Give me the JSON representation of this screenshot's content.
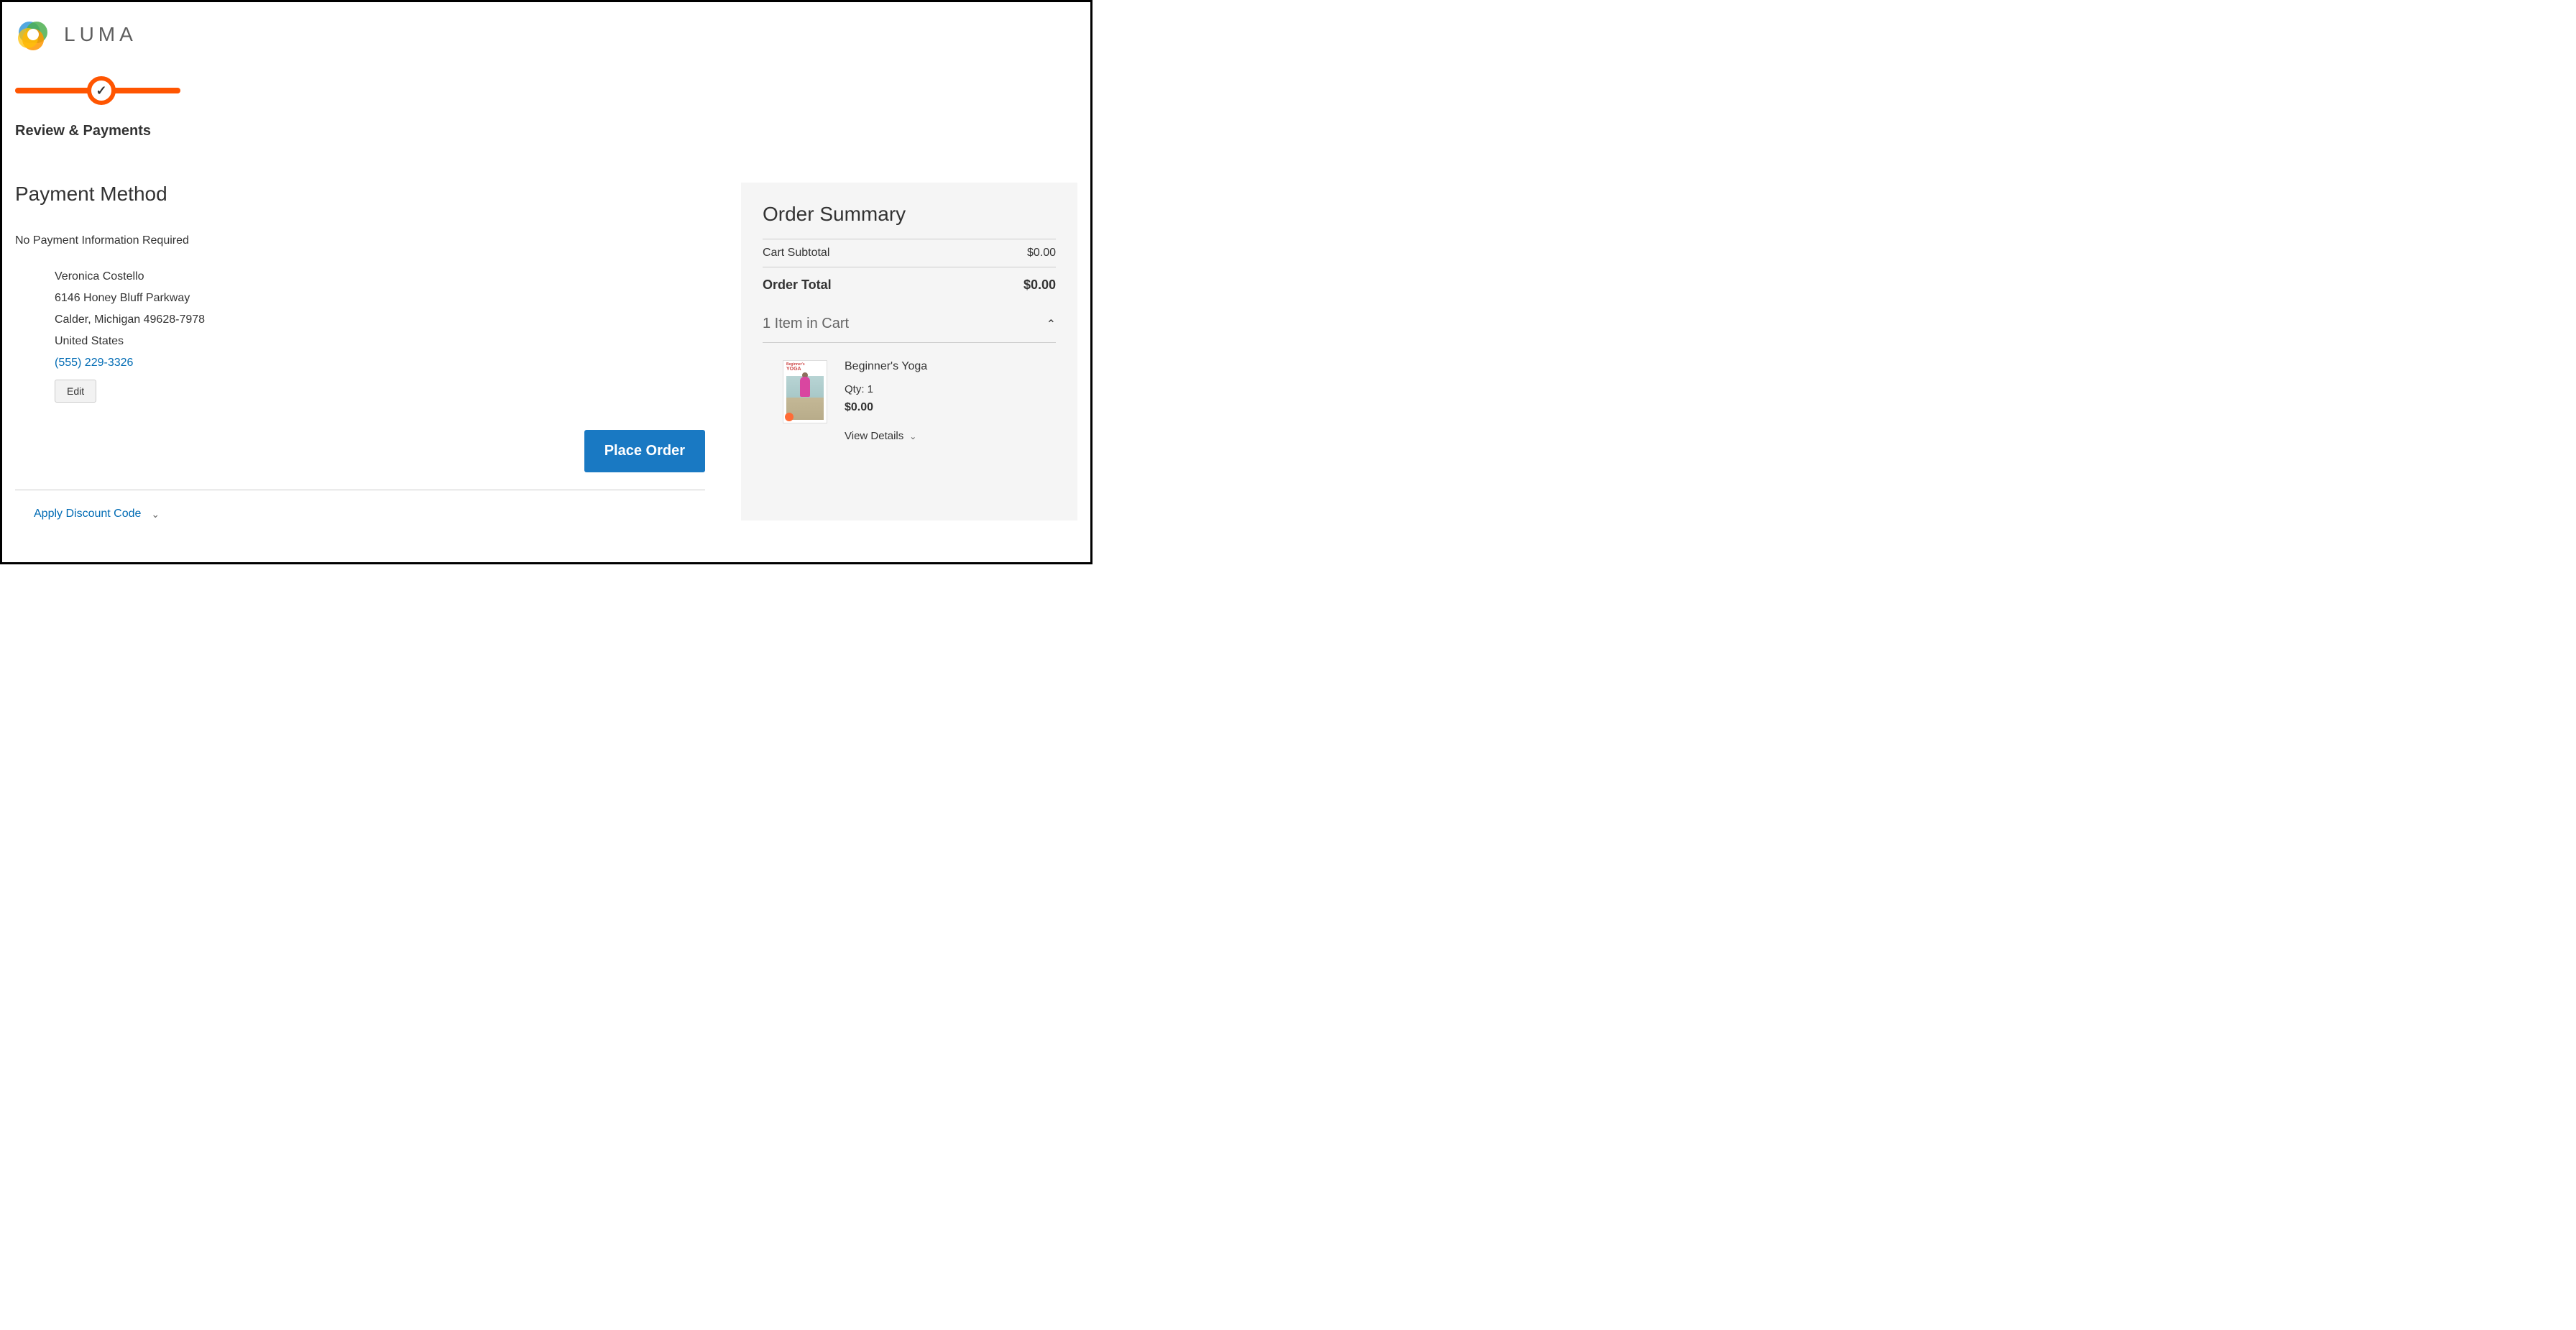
{
  "header": {
    "brand_text": "LUMA"
  },
  "progress": {
    "step_label": "Review & Payments"
  },
  "payment": {
    "title": "Payment Method",
    "no_payment_required": "No Payment Information Required",
    "billing": {
      "name": "Veronica Costello",
      "street": "6146 Honey Bluff Parkway",
      "city_region_zip": "Calder, Michigan 49628-7978",
      "country": "United States",
      "phone": "(555) 229-3326"
    },
    "edit_label": "Edit",
    "place_order_label": "Place Order",
    "apply_discount_label": "Apply Discount Code"
  },
  "summary": {
    "title": "Order Summary",
    "subtotal_label": "Cart Subtotal",
    "subtotal_value": "$0.00",
    "total_label": "Order Total",
    "total_value": "$0.00",
    "cart_count_label": "1 Item in Cart",
    "item": {
      "name": "Beginner's Yoga",
      "qty_label": "Qty: 1",
      "price": "$0.00",
      "view_details_label": "View Details",
      "thumb_line1": "Beginner's",
      "thumb_line2": "YOGA"
    }
  }
}
